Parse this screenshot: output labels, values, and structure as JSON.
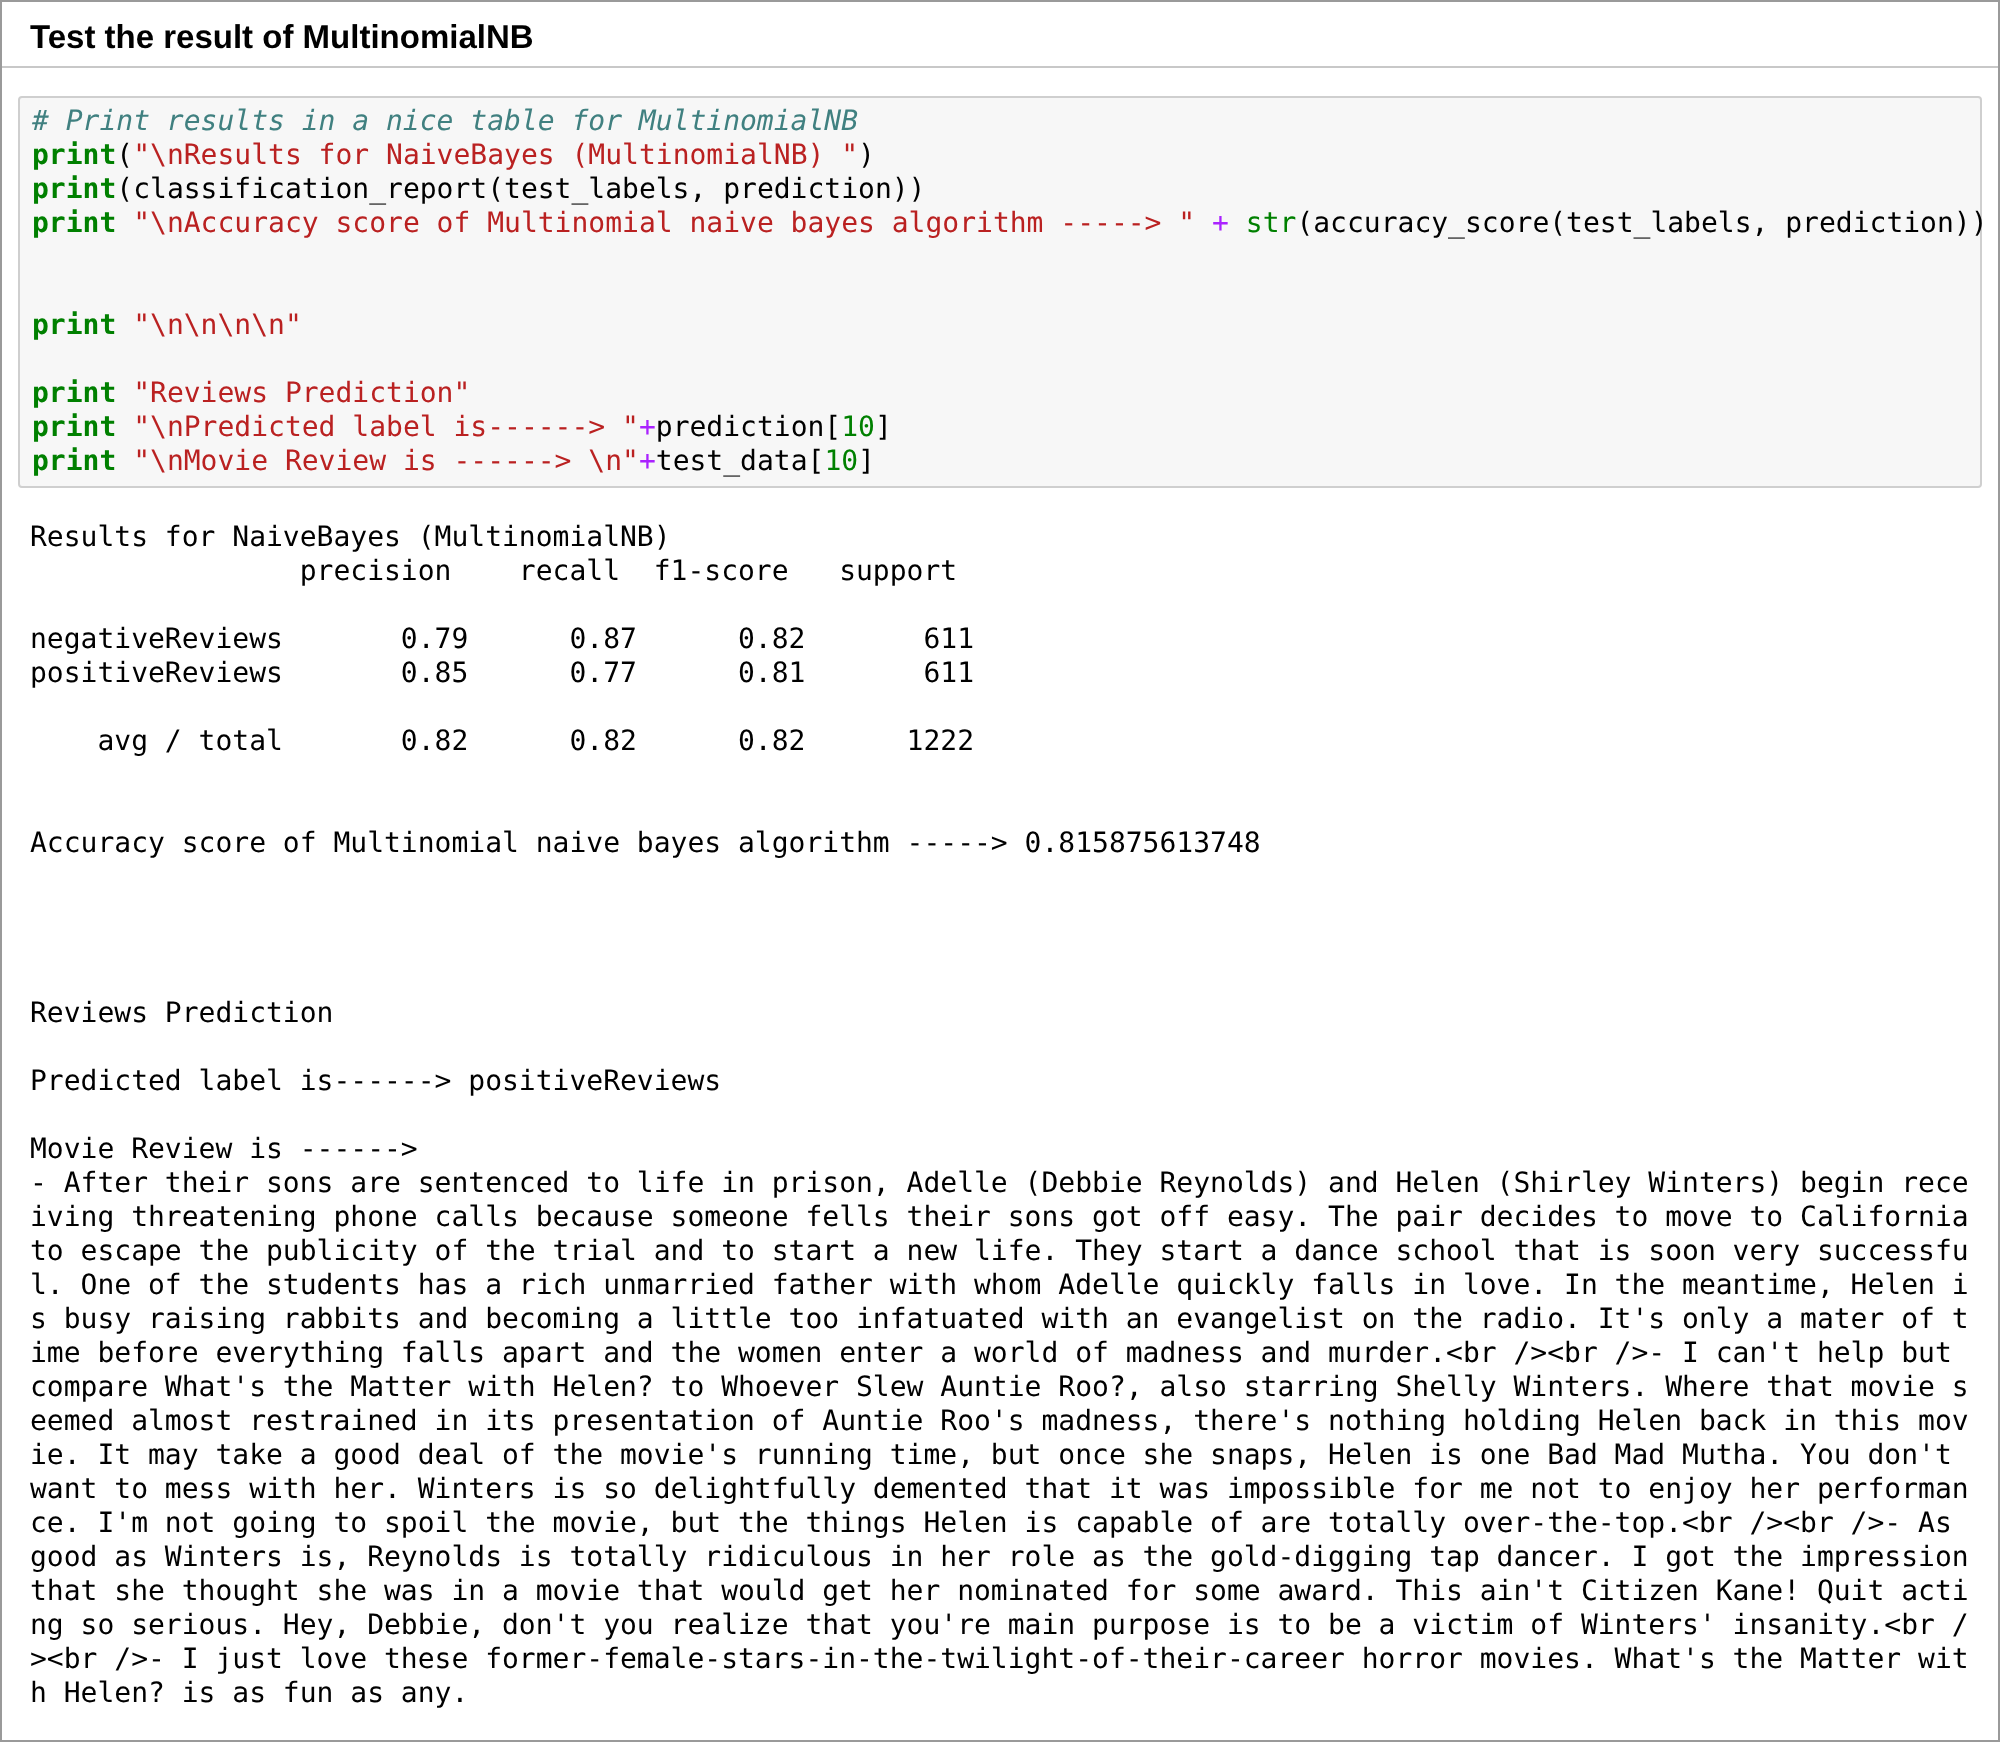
{
  "heading": "Test the result of MultinomialNB",
  "code_blocks": [
    {
      "lines": [
        [
          {
            "kind": "comment",
            "text": "# Print results in a nice table for MultinomialNB"
          }
        ],
        [
          {
            "kind": "keyword",
            "text": "print"
          },
          {
            "kind": "plain",
            "text": "("
          },
          {
            "kind": "string",
            "text": "\"\\nResults for NaiveBayes (MultinomialNB) \""
          },
          {
            "kind": "plain",
            "text": ")"
          }
        ],
        [
          {
            "kind": "keyword",
            "text": "print"
          },
          {
            "kind": "plain",
            "text": "(classification_report(test_labels, prediction))"
          }
        ],
        [
          {
            "kind": "keyword",
            "text": "print"
          },
          {
            "kind": "string",
            "text": " \"\\nAccuracy score of Multinomial naive bayes algorithm -----> \""
          },
          {
            "kind": "operator",
            "text": " + "
          },
          {
            "kind": "builtin",
            "text": "str"
          },
          {
            "kind": "plain",
            "text": "(accuracy_score(test_labels, prediction))"
          }
        ]
      ]
    },
    {
      "lines": [
        [
          {
            "kind": "keyword",
            "text": "print"
          },
          {
            "kind": "string",
            "text": " \"\\n\\n\\n\\n\""
          }
        ]
      ]
    },
    {
      "lines": [
        [
          {
            "kind": "keyword",
            "text": "print"
          },
          {
            "kind": "string",
            "text": " \"Reviews Prediction\""
          }
        ],
        [
          {
            "kind": "keyword",
            "text": "print"
          },
          {
            "kind": "string",
            "text": " \"\\nPredicted label is------> \""
          },
          {
            "kind": "operator",
            "text": "+"
          },
          {
            "kind": "plain",
            "text": "prediction["
          },
          {
            "kind": "number",
            "text": "10"
          },
          {
            "kind": "plain",
            "text": "]"
          }
        ],
        [
          {
            "kind": "keyword",
            "text": "print"
          },
          {
            "kind": "string",
            "text": " \"\\nMovie Review is ------> \\n\""
          },
          {
            "kind": "operator",
            "text": "+"
          },
          {
            "kind": "plain",
            "text": "test_data["
          },
          {
            "kind": "number",
            "text": "10"
          },
          {
            "kind": "plain",
            "text": "]"
          }
        ]
      ]
    }
  ],
  "output_blocks": [
    {
      "lines": [
        "Results for NaiveBayes (MultinomialNB)",
        "                precision    recall  f1-score   support"
      ]
    },
    {
      "lines": [
        "negativeReviews       0.79      0.87      0.82       611",
        "positiveReviews       0.85      0.77      0.81       611"
      ]
    },
    {
      "lines": [
        "    avg / total       0.82      0.82      0.82      1222"
      ]
    },
    {
      "lines": [
        "Accuracy score of Multinomial naive bayes algorithm -----> 0.815875613748"
      ]
    },
    {
      "lines": [
        "Reviews Prediction"
      ]
    },
    {
      "lines": [
        "Predicted label is------> positiveReviews"
      ]
    },
    {
      "lines": [
        "Movie Review is ------>",
        "- After their sons are sentenced to life in prison, Adelle (Debbie Reynolds) and Helen (Shirley Winters) begin rece",
        "iving threatening phone calls because someone fells their sons got off easy. The pair decides to move to California",
        "to escape the publicity of the trial and to start a new life. They start a dance school that is soon very successfu",
        "l. One of the students has a rich unmarried father with whom Adelle quickly falls in love. In the meantime, Helen i",
        "s busy raising rabbits and becoming a little too infatuated with an evangelist on the radio. It's only a mater of t",
        "ime before everything falls apart and the women enter a world of madness and murder.<br /><br />- I can't help but",
        "compare What's the Matter with Helen? to Whoever Slew Auntie Roo?, also starring Shelly Winters. Where that movie s",
        "eemed almost restrained in its presentation of Auntie Roo's madness, there's nothing holding Helen back in this mov",
        "ie. It may take a good deal of the movie's running time, but once she snaps, Helen is one Bad Mad Mutha. You don't",
        "want to mess with her. Winters is so delightfully demented that it was impossible for me not to enjoy her performan",
        "ce. I'm not going to spoil the movie, but the things Helen is capable of are totally over-the-top.<br /><br />- As",
        "good as Winters is, Reynolds is totally ridiculous in her role as the gold-digging tap dancer. I got the impression",
        "that she thought she was in a movie that would get her nominated for some award. This ain't Citizen Kane! Quit acti",
        "ng so serious. Hey, Debbie, don't you realize that you're main purpose is to be a victim of Winters' insanity.<br /",
        "><br />- I just love these former-female-stars-in-the-twilight-of-their-career horror movies. What's the Matter wit",
        "h Helen? is as fun as any."
      ]
    }
  ]
}
